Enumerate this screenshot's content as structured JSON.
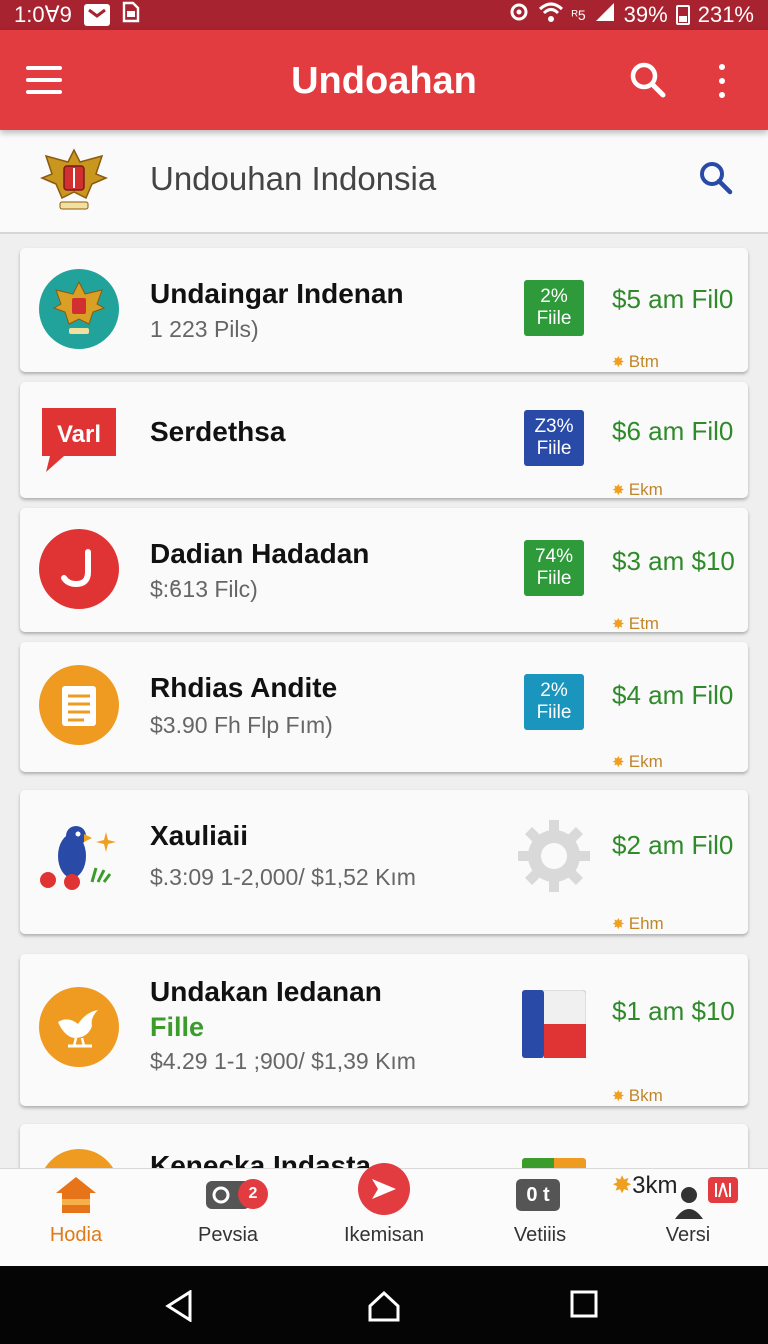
{
  "status_bar": {
    "time": "1:0Ɐ9",
    "network": "ᴿ5",
    "battery": "39%",
    "extra": "231%"
  },
  "app_bar": {
    "title": "Undoahan"
  },
  "sub_header": {
    "title": "Undouhan Indonsia"
  },
  "items": [
    {
      "name": "Undaingar Indenan",
      "sub": "1 223 Pils)",
      "badge_top": "2%",
      "badge_bottom": "Fiile",
      "badge_color": "#2f9a3a",
      "price": "$5 am Fil0",
      "distance": "Btm"
    },
    {
      "name": "Serdethsa",
      "sub": "",
      "badge_top": "Z3%",
      "badge_bottom": "Fiile",
      "badge_color": "#2a4aa8",
      "price": "$6 am Fil0",
      "distance": "Ekm",
      "icon_text": "Varl"
    },
    {
      "name": "Dadian Hadadan",
      "sub": "$:ϐ13 Filc)",
      "badge_top": "74%",
      "badge_bottom": "Fiile",
      "badge_color": "#2f9a3a",
      "price": "$3 am $10",
      "distance": "Etm"
    },
    {
      "name": "Rhdias Andite",
      "sub": "$3.90 Fh Flp Fım)",
      "badge_top": "2%",
      "badge_bottom": "Fiile",
      "badge_color": "#1a95bd",
      "price": "$4 am Fil0",
      "distance": "Ekm"
    },
    {
      "name": "Xauliaii",
      "sub": "$.3:09 1-2,000/ $1,52 Kım",
      "price": "$2 am Fil0",
      "distance": "Ehm"
    },
    {
      "name": "Undakan Iedanan",
      "sub_green": "Fille",
      "sub": "$4.29 1-1 ;900/ $1,39 Kım",
      "price": "$1 am $10",
      "distance": "Bkm"
    },
    {
      "name": "Kenecka Indasta"
    }
  ],
  "bottom_nav": {
    "items": [
      {
        "label": "Hodia",
        "active": true
      },
      {
        "label": "Pevsia",
        "badge": "2"
      },
      {
        "label": "Ikemisan"
      },
      {
        "label": "Vetiiis",
        "glyph": "0 t"
      },
      {
        "label": "Versi",
        "top_text": "3km"
      }
    ]
  },
  "colors": {
    "status_bar": "#a82330",
    "app_bar": "#e23c40",
    "price_green": "#2f8a2a",
    "active_tab": "#e07a16"
  }
}
